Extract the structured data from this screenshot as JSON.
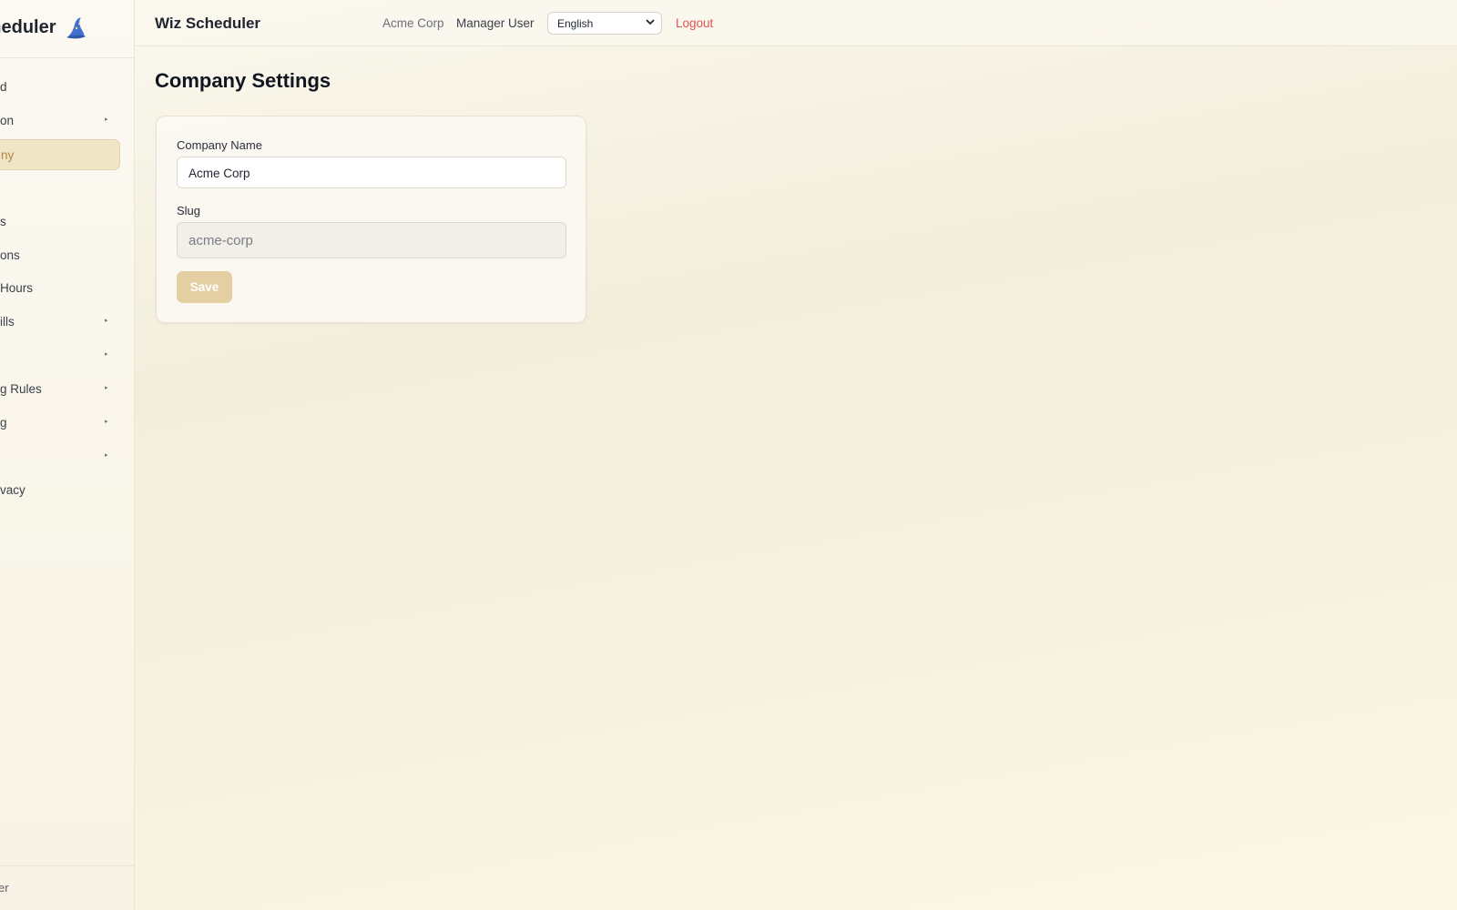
{
  "sidebar": {
    "brand": "Wiz Scheduler",
    "brand_icon": "wizard-hat-icon",
    "items": [
      {
        "label": "Dashboard",
        "visible": "d",
        "caret": false
      },
      {
        "label": "Organization",
        "visible": "on",
        "caret": true
      },
      {
        "label": "Company",
        "visible": "ny",
        "caret": false,
        "active": true
      },
      {
        "label": "Employees",
        "visible": "s",
        "caret": false
      },
      {
        "label": "Positions",
        "visible": "ons",
        "caret": false
      },
      {
        "label": "Opening Hours",
        "visible": "Hours",
        "caret": false
      },
      {
        "label": "Skills",
        "visible": "ills",
        "caret": true
      },
      {
        "label": "",
        "visible": "",
        "caret": true
      },
      {
        "label": "Scheduling Rules",
        "visible": "g Rules",
        "caret": true
      },
      {
        "label": "Scheduling",
        "visible": "g",
        "caret": true
      },
      {
        "label": "",
        "visible": "",
        "caret": true
      },
      {
        "label": "Privacy",
        "visible": "vacy",
        "caret": false
      }
    ],
    "footer": "er"
  },
  "header": {
    "title": "Wiz Scheduler",
    "company": "Acme Corp",
    "user": "Manager User",
    "language": "English",
    "logout": "Logout"
  },
  "main": {
    "title": "Company Settings",
    "form": {
      "company_name_label": "Company Name",
      "company_name_value": "Acme Corp",
      "slug_label": "Slug",
      "slug_value": "acme-corp",
      "save_label": "Save"
    }
  },
  "colors": {
    "accent": "#e4cfa3",
    "active_text": "#b08a3c",
    "logout": "#e05252"
  }
}
